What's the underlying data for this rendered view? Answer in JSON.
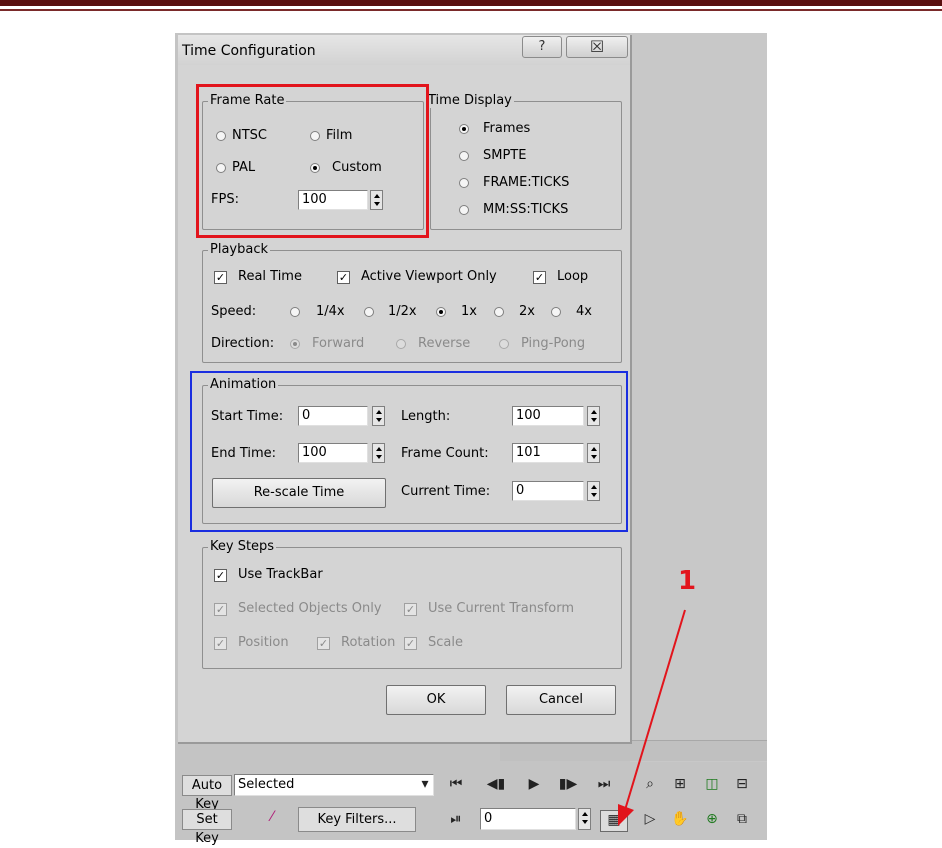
{
  "dialog": {
    "title": "Time Configuration",
    "help_glyph": "?",
    "close_glyph": "☒",
    "frame_rate": {
      "legend": "Frame Rate",
      "ntsc": "NTSC",
      "film": "Film",
      "pal": "PAL",
      "custom": "Custom",
      "fps_label": "FPS:",
      "fps_value": "100",
      "selected": "Custom"
    },
    "time_display": {
      "legend": "Time Display",
      "frames": "Frames",
      "smpte": "SMPTE",
      "frame_ticks": "FRAME:TICKS",
      "mmss_ticks": "MM:SS:TICKS",
      "selected": "Frames"
    },
    "playback": {
      "legend": "Playback",
      "real_time": "Real Time",
      "active_viewport_only": "Active Viewport Only",
      "loop": "Loop",
      "speed_label": "Speed:",
      "speed_options": [
        "1/4x",
        "1/2x",
        "1x",
        "2x",
        "4x"
      ],
      "speed_selected": "1x",
      "direction_label": "Direction:",
      "forward": "Forward",
      "reverse": "Reverse",
      "ping_pong": "Ping-Pong"
    },
    "animation": {
      "legend": "Animation",
      "start_time_label": "Start Time:",
      "start_time_value": "0",
      "end_time_label": "End Time:",
      "end_time_value": "100",
      "length_label": "Length:",
      "length_value": "100",
      "frame_count_label": "Frame Count:",
      "frame_count_value": "101",
      "rescale_button": "Re-scale Time",
      "current_time_label": "Current Time:",
      "current_time_value": "0"
    },
    "key_steps": {
      "legend": "Key Steps",
      "use_trackbar": "Use TrackBar",
      "selected_objects_only": "Selected Objects Only",
      "use_current_transform": "Use Current Transform",
      "position": "Position",
      "rotation": "Rotation",
      "scale": "Scale"
    },
    "ok_button": "OK",
    "cancel_button": "Cancel"
  },
  "toolbar": {
    "auto_key": "Auto Key",
    "selected_dropdown": "Selected",
    "set_key": "Set Key",
    "key_filters": "Key Filters...",
    "current_frame_value": "0"
  },
  "annotation": {
    "label": "1",
    "colors": {
      "red": "#e2141c",
      "blue": "#1a2ee0"
    }
  },
  "icons": [
    "help-icon",
    "close-icon",
    "go-to-start-icon",
    "previous-frame-icon",
    "play-icon",
    "next-frame-icon",
    "go-to-end-icon",
    "key-mode-toggle-icon",
    "time-configuration-icon",
    "zoom-icon",
    "zoom-extents-icon",
    "field-of-view-icon",
    "orbit-icon",
    "pan-icon",
    "maximize-viewport-icon",
    "curve-editor-icon"
  ]
}
